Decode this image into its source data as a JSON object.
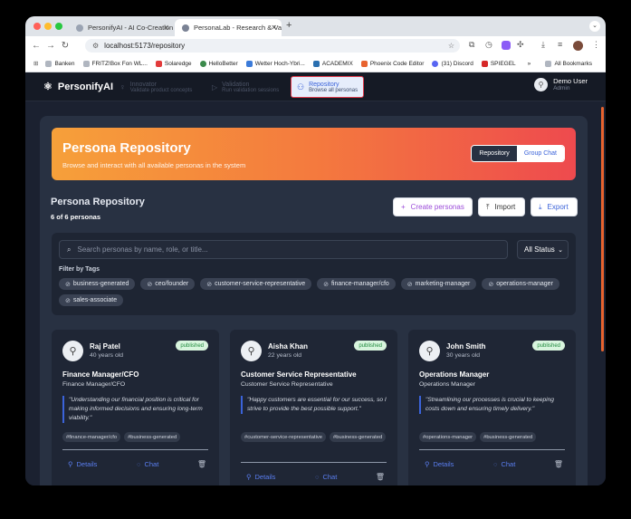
{
  "browser": {
    "tabs": [
      {
        "title": "PersonifyAI - AI Co-Creation P",
        "active": false
      },
      {
        "title": "PersonaLab - Research & Vali",
        "active": true
      }
    ],
    "new_tab": "+",
    "url": "localhost:5173/repository",
    "bookmarks": [
      "Banken",
      "FRITZ!Box Fon WL...",
      "Solaredge",
      "HelloBetter",
      "Wetter Hoch-Ybri...",
      "ACADEMIX",
      "Phoenix Code Editor",
      "(31) Discord",
      "SPIEGEL"
    ],
    "more": "»",
    "all_bookmarks": "All Bookmarks"
  },
  "app": {
    "brand": "PersonifyAI",
    "nav": [
      {
        "title": "Innovator",
        "subtitle": "Validate product concepts",
        "icon": "lightbulb-icon",
        "active": false
      },
      {
        "title": "Validation",
        "subtitle": "Run validation sessions",
        "icon": "play-icon",
        "active": false
      },
      {
        "title": "Repository",
        "subtitle": "Browse all personas",
        "icon": "users-icon",
        "active": true
      }
    ],
    "user": {
      "name": "Demo User",
      "role": "Admin"
    }
  },
  "hero": {
    "title": "Persona Repository",
    "subtitle": "Browse and interact with all available personas in the system",
    "toggle": [
      "Repository",
      "Group Chat"
    ]
  },
  "section": {
    "title": "Persona Repository",
    "count": "6 of 6 personas",
    "create": "Create personas",
    "import": "Import",
    "export": "Export"
  },
  "filters": {
    "search_placeholder": "Search personas by name, role, or title...",
    "status": "All Status",
    "tags_title": "Filter by Tags",
    "tags": [
      "business-generated",
      "ceo/founder",
      "customer-service-representative",
      "finance-manager/cfo",
      "marketing-manager",
      "operations-manager",
      "sales-associate"
    ]
  },
  "cards": [
    {
      "name": "Raj Patel",
      "age": "40 years old",
      "status": "published",
      "role": "Finance Manager/CFO",
      "subtitle": "Finance Manager/CFO",
      "quote": "\"Understanding our financial position is critical for making informed decisions and ensuring long-term viability.\"",
      "tags": [
        "#finance-manager/cfo",
        "#business-generated"
      ],
      "details": "Details",
      "chat": "Chat"
    },
    {
      "name": "Aisha Khan",
      "age": "22 years old",
      "status": "published",
      "role": "Customer Service Representative",
      "subtitle": "Customer Service Representative",
      "quote": "\"Happy customers are essential for our success, so I strive to provide the best possible support.\"",
      "tags": [
        "#customer-service-representative",
        "#business-generated"
      ],
      "details": "Details",
      "chat": "Chat"
    },
    {
      "name": "John Smith",
      "age": "30 years old",
      "status": "published",
      "role": "Operations Manager",
      "subtitle": "Operations Manager",
      "quote": "\"Streamlining our processes is crucial to keeping costs down and ensuring timely delivery.\"",
      "tags": [
        "#operations-manager",
        "#business-generated"
      ],
      "details": "Details",
      "chat": "Chat"
    }
  ],
  "colors": {
    "accent": "#3b63d9",
    "hero_start": "#f6a03a",
    "hero_end": "#ee4a4e",
    "published": "#1f8a3d"
  }
}
